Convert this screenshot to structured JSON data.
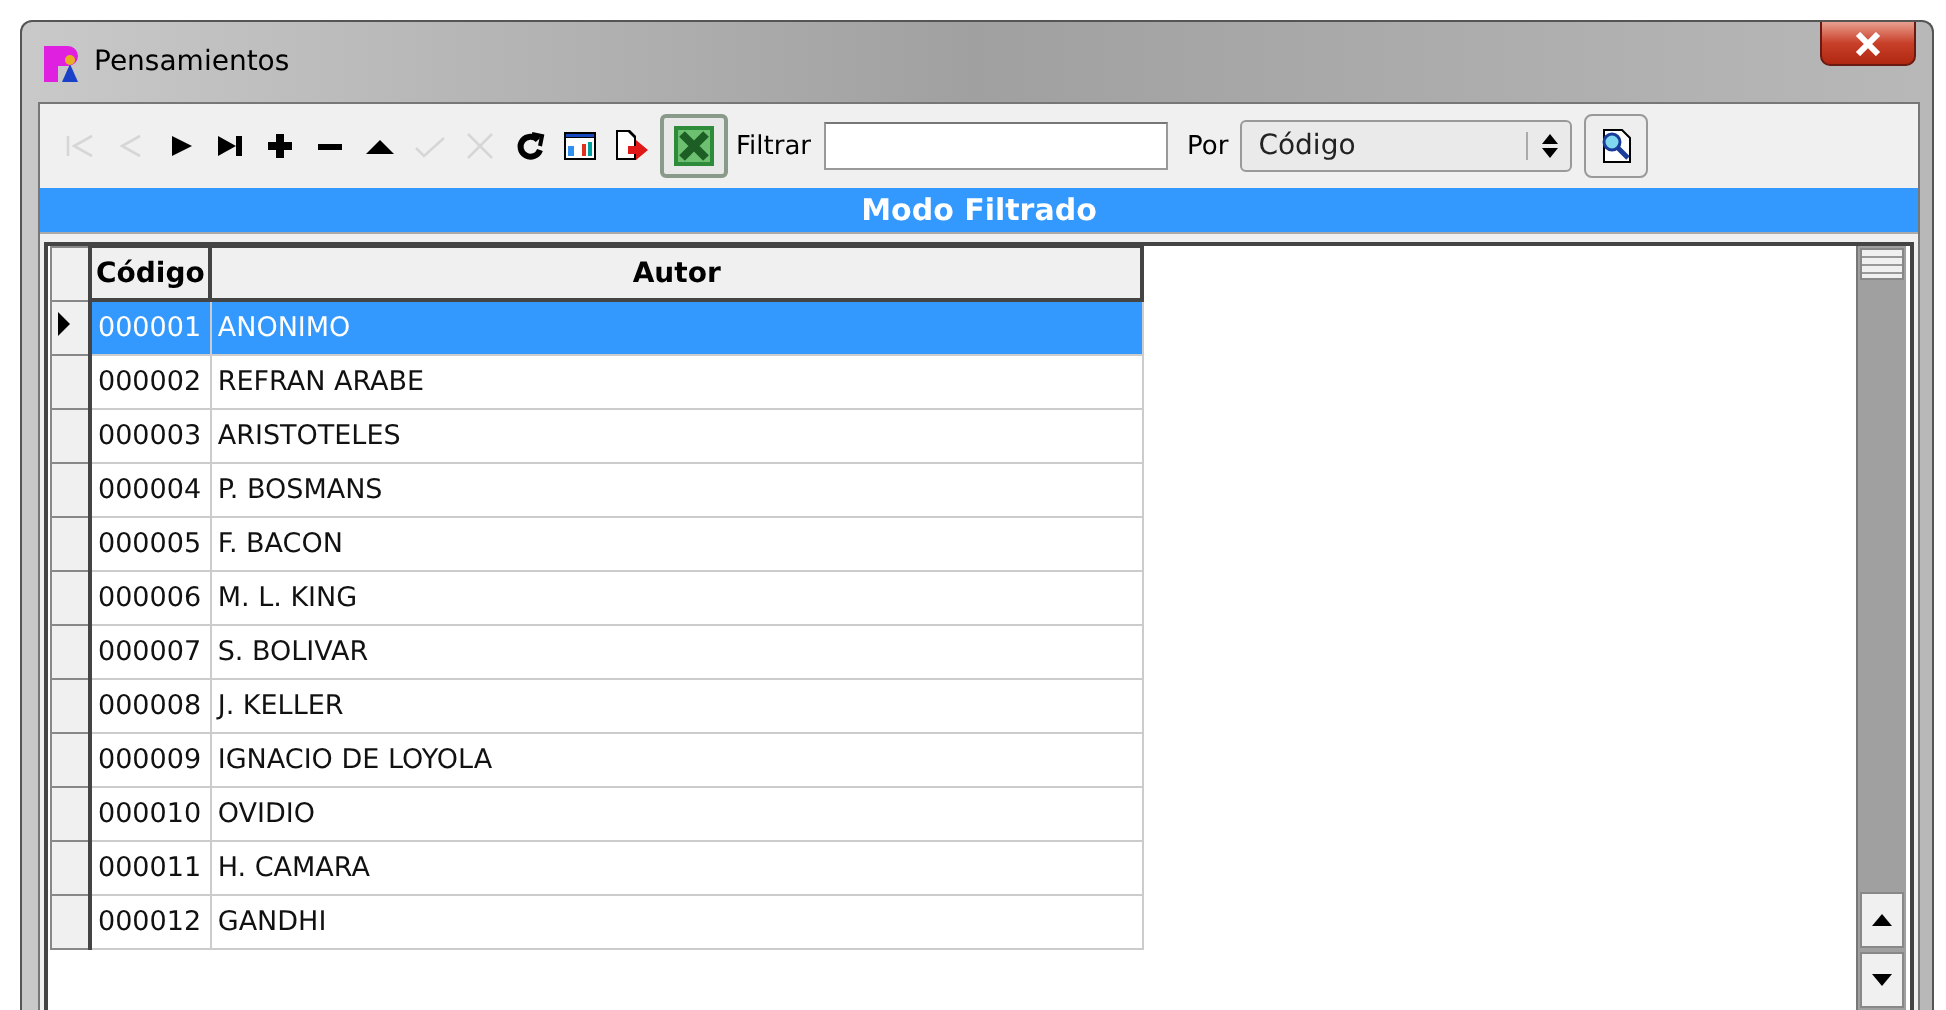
{
  "window": {
    "title": "Pensamientos"
  },
  "toolbar": {
    "buttons": [
      {
        "kind": "first",
        "disabled": true
      },
      {
        "kind": "prior",
        "disabled": true
      },
      {
        "kind": "next",
        "disabled": false
      },
      {
        "kind": "last",
        "disabled": false
      },
      {
        "kind": "insert",
        "disabled": false
      },
      {
        "kind": "delete",
        "disabled": false
      },
      {
        "kind": "edit",
        "disabled": false
      },
      {
        "kind": "post",
        "disabled": true
      },
      {
        "kind": "cancel",
        "disabled": true
      },
      {
        "kind": "refresh",
        "disabled": false
      },
      {
        "kind": "report",
        "disabled": false
      },
      {
        "kind": "export",
        "disabled": false
      },
      {
        "kind": "excel",
        "disabled": false
      }
    ],
    "filter_label": "Filtrar",
    "by_label": "Por",
    "by_select": "Código"
  },
  "mode_banner": "Modo Filtrado",
  "table": {
    "columns": [
      "Código",
      "Autor"
    ],
    "rows": [
      {
        "code": "000001",
        "author": "ANONIMO",
        "selected": true
      },
      {
        "code": "000002",
        "author": "REFRAN ARABE",
        "selected": false
      },
      {
        "code": "000003",
        "author": "ARISTOTELES",
        "selected": false
      },
      {
        "code": "000004",
        "author": "P. BOSMANS",
        "selected": false
      },
      {
        "code": "000005",
        "author": "F. BACON",
        "selected": false
      },
      {
        "code": "000006",
        "author": "M. L. KING",
        "selected": false
      },
      {
        "code": "000007",
        "author": "S. BOLIVAR",
        "selected": false
      },
      {
        "code": "000008",
        "author": "J. KELLER",
        "selected": false
      },
      {
        "code": "000009",
        "author": "IGNACIO DE LOYOLA",
        "selected": false
      },
      {
        "code": "000010",
        "author": "OVIDIO",
        "selected": false
      },
      {
        "code": "000011",
        "author": "H. CAMARA",
        "selected": false
      },
      {
        "code": "000012",
        "author": "GANDHI",
        "selected": false
      }
    ]
  }
}
